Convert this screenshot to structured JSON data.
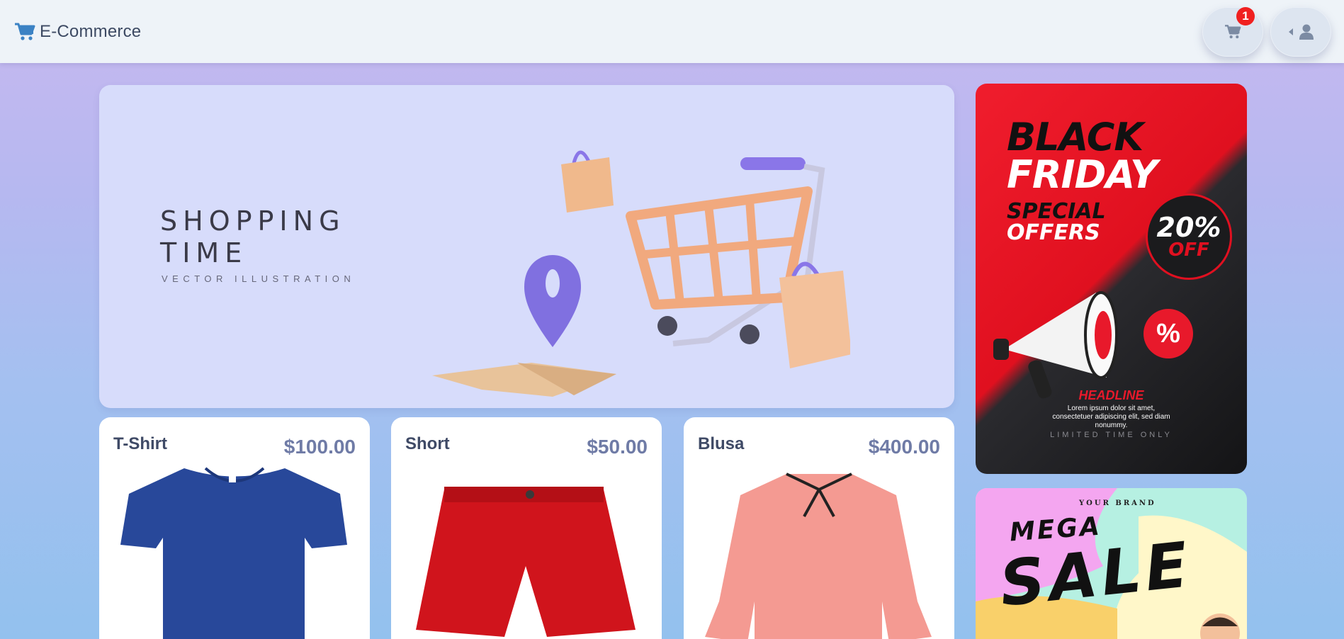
{
  "header": {
    "brand_name": "E-Commerce",
    "brand_icon": "cart-icon",
    "cart_button_icon": "cart-icon",
    "cart_badge_count": "1",
    "user_button_icon": "user-icon",
    "accent_color": "#3b82c4",
    "badge_color": "#f02020"
  },
  "hero": {
    "title": "SHOPPING\nTIME",
    "subtitle": "VECTOR ILLUSTRATION"
  },
  "products": [
    {
      "name": "T-Shirt",
      "price": "$100.00",
      "color": "#28489a"
    },
    {
      "name": "Short",
      "price": "$50.00",
      "color": "#d0141c"
    },
    {
      "name": "Blusa",
      "price": "$400.00",
      "color": "#f49a92"
    }
  ],
  "banner_black_friday": {
    "line1": "BLACK",
    "line2": "FRIDAY",
    "line3": "SPECIAL",
    "line4": "OFFERS",
    "discount": "20%",
    "discount_suffix": "OFF",
    "percent_badge": "%",
    "headline": "HEADLINE",
    "body": "Lorem ipsum dolor sit amet, consectetuer adipiscing elit, sed diam nonummy.",
    "footer": "LIMITED TIME ONLY"
  },
  "banner_mega_sale": {
    "brand": "YOUR BRAND",
    "line1": "MEGA",
    "line2": "SALE"
  }
}
